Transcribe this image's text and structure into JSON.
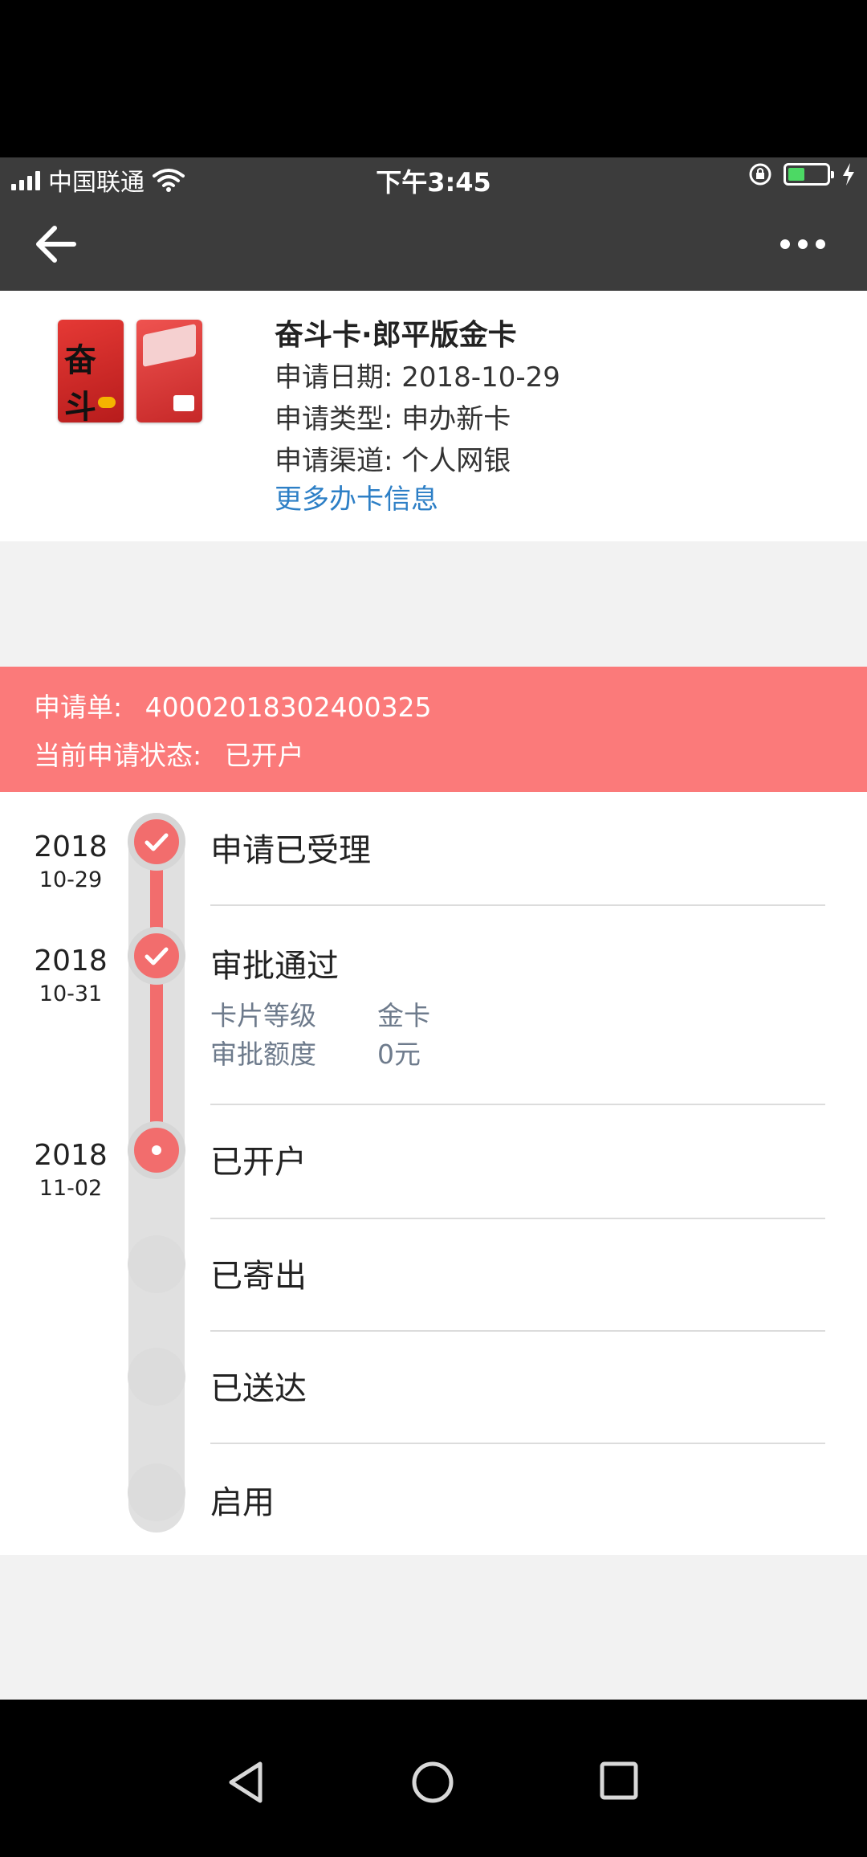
{
  "status_bar": {
    "carrier": "中国联通",
    "time": "下午3:45"
  },
  "card": {
    "title": "奋斗卡·郎平版金卡",
    "apply_date_label": "申请日期:",
    "apply_date": "2018-10-29",
    "apply_type_label": "申请类型:",
    "apply_type": "申办新卡",
    "apply_channel_label": "申请渠道:",
    "apply_channel": "个人网银",
    "more_info_link": "更多办卡信息",
    "front_glyph": "奋斗"
  },
  "banner": {
    "order_label": "申请单:",
    "order_no": "40002018302400325",
    "status_label": "当前申请状态:",
    "status": "已开户"
  },
  "timeline": {
    "steps": [
      {
        "year": "2018",
        "md": "10-29",
        "label": "申请已受理",
        "state": "done"
      },
      {
        "year": "2018",
        "md": "10-31",
        "label": "审批通过",
        "state": "done",
        "details": [
          {
            "key": "卡片等级",
            "value": "金卡"
          },
          {
            "key": "审批额度",
            "value": "0元"
          }
        ]
      },
      {
        "year": "2018",
        "md": "11-02",
        "label": "已开户",
        "state": "current"
      },
      {
        "label": "已寄出",
        "state": "pending"
      },
      {
        "label": "已送达",
        "state": "pending"
      },
      {
        "label": "启用",
        "state": "pending"
      }
    ]
  },
  "colors": {
    "accent": "#f26d6d",
    "banner": "#fb7a7a",
    "link": "#2d7fc6",
    "header": "#3c3c3c"
  },
  "icons": {
    "back": "arrow-left-icon",
    "more": "more-dots-icon",
    "done": "check-icon",
    "android_back": "triangle-back-icon",
    "android_home": "circle-home-icon",
    "android_recents": "square-recents-icon"
  }
}
